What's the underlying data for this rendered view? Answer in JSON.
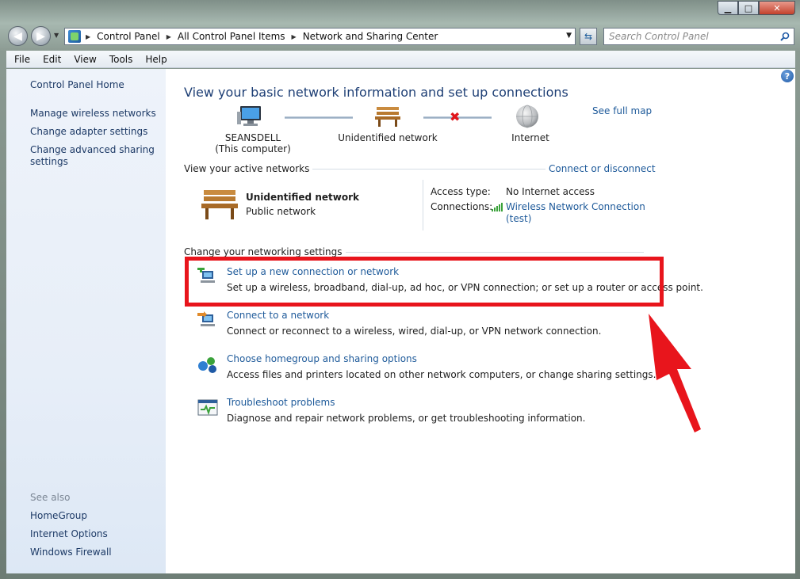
{
  "window": {
    "caption_minimize": "▁",
    "caption_maximize": "□",
    "caption_close": "✕"
  },
  "address": {
    "breadcrumbs": [
      "Control Panel",
      "All Control Panel Items",
      "Network and Sharing Center"
    ],
    "search_placeholder": "Search Control Panel"
  },
  "menu": [
    "File",
    "Edit",
    "View",
    "Tools",
    "Help"
  ],
  "sidebar": {
    "home": "Control Panel Home",
    "links": [
      "Manage wireless networks",
      "Change adapter settings",
      "Change advanced sharing settings"
    ],
    "see_also_label": "See also",
    "see_also": [
      "HomeGroup",
      "Internet Options",
      "Windows Firewall"
    ]
  },
  "main": {
    "heading": "View your basic network information and set up connections",
    "see_full_map": "See full map",
    "map": {
      "computer_name": "SEANSDELL",
      "computer_sub": "(This computer)",
      "network": "Unidentified network",
      "internet": "Internet"
    },
    "active_networks": {
      "label": "View your active networks",
      "connect_link": "Connect or disconnect",
      "name": "Unidentified network",
      "type": "Public network",
      "access_type_key": "Access type:",
      "access_type_val": "No Internet access",
      "connections_key": "Connections:",
      "connections_val_line1": "Wireless Network Connection",
      "connections_val_line2": "(test)"
    },
    "change_settings_label": "Change your networking settings",
    "tasks": [
      {
        "title": "Set up a new connection or network",
        "desc": "Set up a wireless, broadband, dial-up, ad hoc, or VPN connection; or set up a router or access point.",
        "icon": "new-connection-icon"
      },
      {
        "title": "Connect to a network",
        "desc": "Connect or reconnect to a wireless, wired, dial-up, or VPN network connection.",
        "icon": "connect-network-icon"
      },
      {
        "title": "Choose homegroup and sharing options",
        "desc": "Access files and printers located on other network computers, or change sharing settings.",
        "icon": "homegroup-icon"
      },
      {
        "title": "Troubleshoot problems",
        "desc": "Diagnose and repair network problems, or get troubleshooting information.",
        "icon": "troubleshoot-icon"
      }
    ]
  },
  "colors": {
    "link": "#1e5a9a",
    "heading": "#1e3f75",
    "annotation_red": "#e8151c"
  }
}
